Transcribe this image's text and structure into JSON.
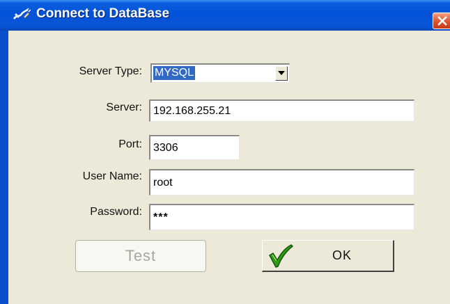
{
  "window": {
    "title": "Connect to DataBase",
    "title_icon": "connection-plug-icon",
    "close_icon": "close-icon",
    "colors": {
      "titlebar": "#0351d6",
      "face": "#ece9d8",
      "close": "#d64a22",
      "selection": "#316ac5",
      "ok_check": "#2f9b12"
    }
  },
  "form": {
    "server_type": {
      "label": "Server Type:",
      "value": "MYSQL",
      "dropdown_icon": "chevron-down-icon"
    },
    "server": {
      "label": "Server:",
      "value": "192.168.255.21"
    },
    "port": {
      "label": "Port:",
      "value": "3306"
    },
    "user_name": {
      "label": "User Name:",
      "value": "root"
    },
    "password": {
      "label": "Password:",
      "value": "***"
    }
  },
  "buttons": {
    "test": {
      "label": "Test",
      "enabled": false
    },
    "ok": {
      "label": "OK",
      "icon": "checkmark-icon",
      "enabled": true
    }
  }
}
